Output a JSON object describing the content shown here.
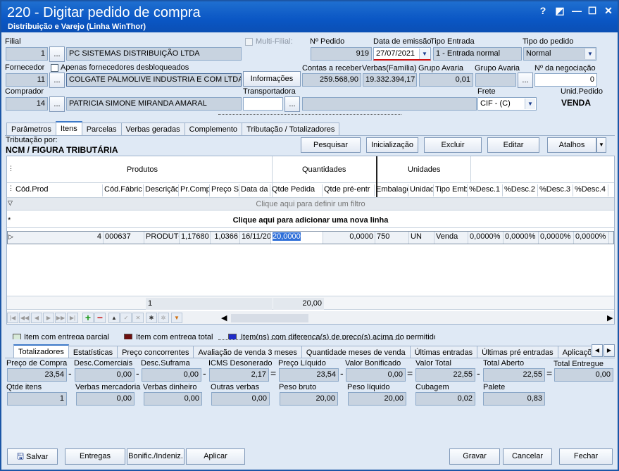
{
  "window": {
    "title": "220 - Digitar pedido de compra",
    "subtitle": "Distribuição e Varejo (Linha WinThor)",
    "help": "?",
    "min": "—",
    "max": "☐",
    "close": "✕",
    "restore": "◩"
  },
  "header": {
    "filial_label": "Filial",
    "filial_code": "1",
    "filial_name": "PC SISTEMAS DISTRIBUIÇÃO LTDA",
    "multifilial_label": "Multi-Filial:",
    "npedido_label": "Nº Pedido",
    "npedido": "919",
    "data_label": "Data de emissão",
    "data": "27/07/2021",
    "tipo_entrada_label": "Tipo Entrada",
    "tipo_entrada": "1 - Entrada normal",
    "tipo_pedido_label": "Tipo do pedido",
    "tipo_pedido": "Normal",
    "fornecedor_label": "Fornecedor",
    "apenas_label": "Apenas fornecedores desbloqueados",
    "fornecedor_code": "11",
    "fornecedor_name": "COLGATE PALMOLIVE INDUSTRIA  E COM LTDA",
    "informacoes": "Informações",
    "contas_label": "Contas a receber",
    "contas": "259.568,90",
    "verbas_label": "Verbas(Família)",
    "verbas": "19.332.394,17",
    "grupo_avaria_label": "Grupo Avaria",
    "grupo_avaria": "0,01",
    "grupo_avaria2_label": "Grupo Avaria",
    "negociacao_label": "Nº da negociação",
    "negociacao": "0",
    "comprador_label": "Comprador",
    "comprador_code": "14",
    "comprador_name": "PATRICIA SIMONE MIRANDA AMARAL",
    "transportadora_label": "Transportadora",
    "frete_label": "Frete",
    "frete": "CIF - (C)",
    "unid_label": "Unid.Pedido",
    "unid": "VENDA",
    "ellipsis": "..."
  },
  "tabs": [
    "Parâmetros",
    "Itens",
    "Parcelas",
    "Verbas geradas",
    "Complemento",
    "Tributação / Totalizadores"
  ],
  "tributacao_label": "Tributação por:",
  "tributacao_value": "NCM / FIGURA TRIBUTÁRIA",
  "toolbar": {
    "pesquisar": "Pesquisar",
    "inicializacao": "Inicialização",
    "excluir": "Excluir",
    "editar": "Editar",
    "atalhos": "Atalhos"
  },
  "grid": {
    "groups": {
      "produtos": "Produtos",
      "quantidades": "Quantidades",
      "unidades": "Unidades"
    },
    "columns": [
      "Cód.Prod",
      "Cód.Fábric",
      "Descrição",
      "Pr.Comp",
      "Preço S",
      "Data da",
      "Qtde Pedida",
      "Qtde pré-entr",
      "Embalage",
      "Unidad",
      "Tipo Emb",
      "%Desc.1",
      "%Desc.2",
      "%Desc.3",
      "%Desc.4"
    ],
    "filter_text": "Clique aqui para definir um filtro",
    "new_row_text": "Clique aqui para adicionar uma nova linha",
    "row": [
      "4",
      "000637",
      "PRODUTO",
      "1,17680",
      "1,0366",
      "16/11/20",
      "20,0000",
      "0,0000",
      "750",
      "UN",
      "Venda",
      "0,0000%",
      "0,0000%",
      "0,0000%",
      "0,0000%"
    ],
    "summary_count": "1",
    "summary_total": "20,00"
  },
  "legend": [
    "Item com entrega parcial",
    "Item com entrega total",
    "Item(ns) com diferença(s) de preço(s) acima do permitido"
  ],
  "legend_colors": [
    "#d8ead8",
    "#6e1010",
    "#1f2cc8"
  ],
  "bottom_tabs": [
    "Totalizadores",
    "Estatísticas",
    "Preço concorrentes",
    "Avaliação de venda 3 meses",
    "Quantidade meses de venda",
    "Últimas entradas",
    "Últimas pré entradas",
    "Aplicações"
  ],
  "totals": {
    "preco_compra_label": "Preço de Compra",
    "preco_compra": "23,54",
    "desc_com_label": "Desc.Comerciais",
    "desc_com": "0,00",
    "desc_suf_label": "Desc.Suframa",
    "desc_suf": "0,00",
    "icms_label": "ICMS Desonerado",
    "icms": "2,17",
    "preco_liq_label": "Preço Líquido",
    "preco_liq": "23,54",
    "valor_bon_label": "Valor Bonificado",
    "valor_bon": "0,00",
    "valor_total_label": "Valor Total",
    "valor_total": "22,55",
    "total_aberto_label": "Total Aberto",
    "total_aberto": "22,55",
    "total_entregue_label": "Total Entregue",
    "total_entregue": "0,00",
    "qtde_itens_label": "Qtde itens",
    "qtde_itens": "1",
    "verbas_merc_label": "Verbas mercadoria",
    "verbas_merc": "0,00",
    "verbas_din_label": "Verbas dinheiro",
    "verbas_din": "0,00",
    "outras_label": "Outras verbas",
    "outras": "0,00",
    "peso_bruto_label": "Peso bruto",
    "peso_bruto": "20,00",
    "peso_liq_label": "Peso líquido",
    "peso_liq": "20,00",
    "cubagem_label": "Cubagem",
    "cubagem": "0,02",
    "palete_label": "Palete",
    "palete": "0,83"
  },
  "footer": {
    "salvar": "Salvar",
    "entregas": "Entregas",
    "bonific": "Bonific./Indeniz.",
    "aplicar": "Aplicar",
    "gravar": "Gravar",
    "cancelar": "Cancelar",
    "fechar": "Fechar"
  }
}
